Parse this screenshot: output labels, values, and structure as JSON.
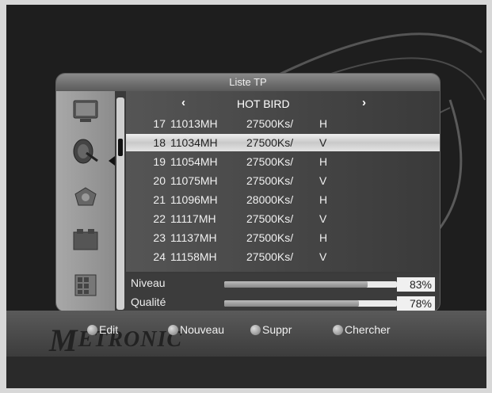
{
  "panel": {
    "title": "Liste TP"
  },
  "list": {
    "satellite": "HOT BIRD",
    "left_arrow": "‹",
    "right_arrow": "›",
    "rows": [
      {
        "num": "17",
        "freq": "11013MH",
        "sym": "27500Ks/",
        "pol": "H"
      },
      {
        "num": "18",
        "freq": "11034MH",
        "sym": "27500Ks/",
        "pol": "V"
      },
      {
        "num": "19",
        "freq": "11054MH",
        "sym": "27500Ks/",
        "pol": "H"
      },
      {
        "num": "20",
        "freq": "11075MH",
        "sym": "27500Ks/",
        "pol": "V"
      },
      {
        "num": "21",
        "freq": "11096MH",
        "sym": "28000Ks/",
        "pol": "H"
      },
      {
        "num": "22",
        "freq": "11117MH",
        "sym": "27500Ks/",
        "pol": "V"
      },
      {
        "num": "23",
        "freq": "11137MH",
        "sym": "27500Ks/",
        "pol": "H"
      },
      {
        "num": "24",
        "freq": "11158MH",
        "sym": "27500Ks/",
        "pol": "V"
      }
    ],
    "selected_index": 1
  },
  "meters": {
    "niveau": {
      "label": "Niveau",
      "value": "83%",
      "fraction": 0.83
    },
    "qualite": {
      "label": "Qualité",
      "value": "78%",
      "fraction": 0.78
    }
  },
  "bottom": {
    "logo": "ETRONIC",
    "logo_initial": "M",
    "buttons": {
      "edit": "Edit",
      "nouveau": "Nouveau",
      "suppr": "Suppr",
      "chercher": "Chercher"
    }
  },
  "icons": [
    "tv-icon",
    "satellite-dish-icon",
    "network-icon",
    "module-icon",
    "grid-icon"
  ]
}
